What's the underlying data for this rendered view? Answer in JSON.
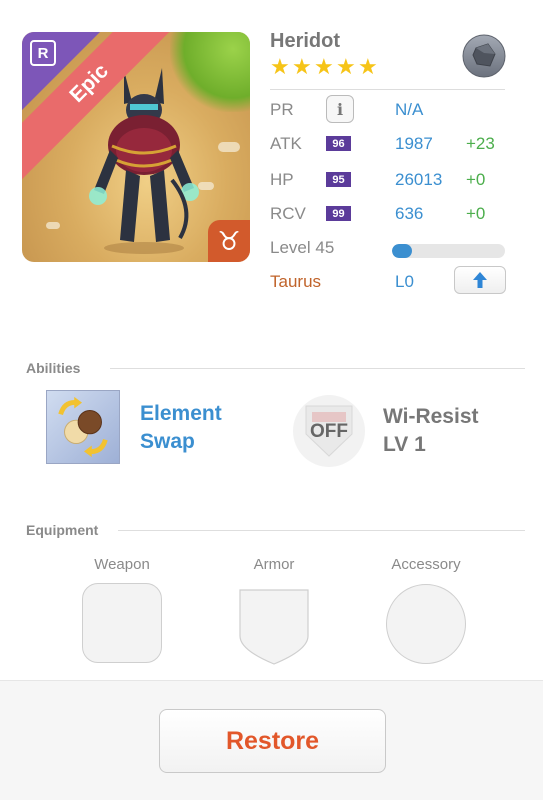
{
  "monster": {
    "name": "Heridot",
    "stars": 5,
    "rarity_label": "Epic",
    "rarity_badge": "R",
    "zodiac_symbol": "♉",
    "element_icon": "rock-element-icon"
  },
  "stats": {
    "pr": {
      "label": "PR",
      "value": "N/A"
    },
    "atk": {
      "label": "ATK",
      "level": "96",
      "value": "1987",
      "bonus": "+23"
    },
    "hp": {
      "label": "HP",
      "level": "95",
      "value": "26013",
      "bonus": "+0"
    },
    "rcv": {
      "label": "RCV",
      "level": "99",
      "value": "636",
      "bonus": "+0"
    },
    "level": {
      "label": "Level 45",
      "progress": 0.18
    },
    "zodiac": {
      "label": "Taurus",
      "value": "L0"
    }
  },
  "abilities": {
    "header": "Abilities",
    "items": [
      {
        "name_line1": "Element",
        "name_line2": "Swap",
        "icon": "element-swap-icon"
      },
      {
        "name_line1": "Wi-Resist",
        "name_line2": "LV 1",
        "icon": "off-shield-icon",
        "badge": "OFF"
      }
    ]
  },
  "equipment": {
    "header": "Equipment",
    "slots": [
      {
        "label": "Weapon"
      },
      {
        "label": "Armor"
      },
      {
        "label": "Accessory"
      }
    ]
  },
  "footer": {
    "restore_label": "Restore"
  },
  "colors": {
    "accent_blue": "#3b8fd0",
    "bonus_green": "#4cae4c",
    "restore_orange": "#e2572a",
    "rarity_red": "#e96b6b",
    "level_purple": "#5b3b9a"
  }
}
